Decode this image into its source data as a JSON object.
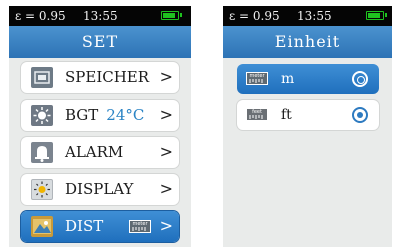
{
  "left_screen": {
    "status": {
      "emissivity": "ε = 0.95",
      "time": "13:55",
      "battery_level": 0.8
    },
    "title": "SET",
    "items": [
      {
        "label": "SPEICHER",
        "icon": "speicher-icon"
      },
      {
        "label": "BGT",
        "value": "24°C",
        "icon": "bgt-icon"
      },
      {
        "label": "ALARM",
        "icon": "alarm-icon"
      },
      {
        "label": "DISPLAY",
        "icon": "display-icon"
      },
      {
        "label": "DIST",
        "icon": "dist-icon",
        "unit_badge": "meter",
        "selected": true
      }
    ],
    "chevron": ">"
  },
  "right_screen": {
    "status": {
      "emissivity": "ε = 0.95",
      "time": "13:55",
      "battery_level": 0.8
    },
    "title": "Einheit",
    "options": [
      {
        "label": "m",
        "badge": "meter",
        "selected": true
      },
      {
        "label": "ft",
        "badge": "feet",
        "selected": false
      }
    ]
  },
  "colors": {
    "accent": "#2d73b5",
    "status_bar": "#050505",
    "battery": "#1fc21f",
    "value_text": "#2b84c5"
  }
}
